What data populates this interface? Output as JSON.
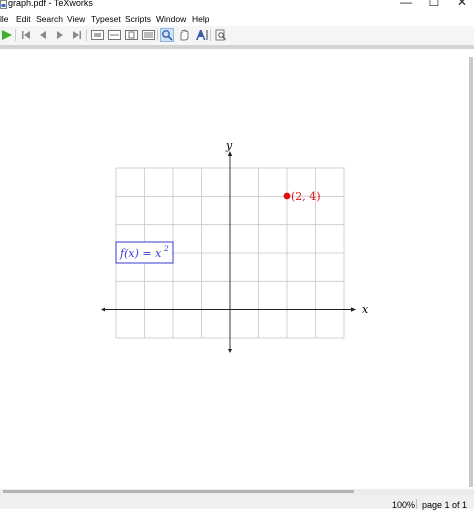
{
  "window": {
    "title": "graph.pdf - TeXworks",
    "minimize_glyph": "—",
    "maximize_glyph": "☐",
    "close_glyph": "✕"
  },
  "menu": {
    "items": [
      "lle",
      "Edit",
      "Search",
      "View",
      "Typeset",
      "Scripts",
      "Window",
      "Help"
    ]
  },
  "toolbar": {
    "icons": [
      "typeset-play-icon",
      "first-page-icon",
      "previous-page-icon",
      "next-page-icon",
      "last-page-icon",
      "actual-size-icon",
      "fit-width-icon",
      "fit-window-icon",
      "full-screen-icon",
      "magnify-tool-icon",
      "scroll-tool-icon",
      "select-text-icon",
      "find-icon"
    ]
  },
  "document": {
    "axis_x_label": "x",
    "axis_y_label": "y",
    "point_label": "(2, 4)",
    "function_box_text": "f(x) = x",
    "function_exponent": "2",
    "point_color": "#e01010",
    "box_color": "#3a3ad0"
  },
  "status": {
    "zoom": "100%",
    "page": "page 1 of 1"
  }
}
